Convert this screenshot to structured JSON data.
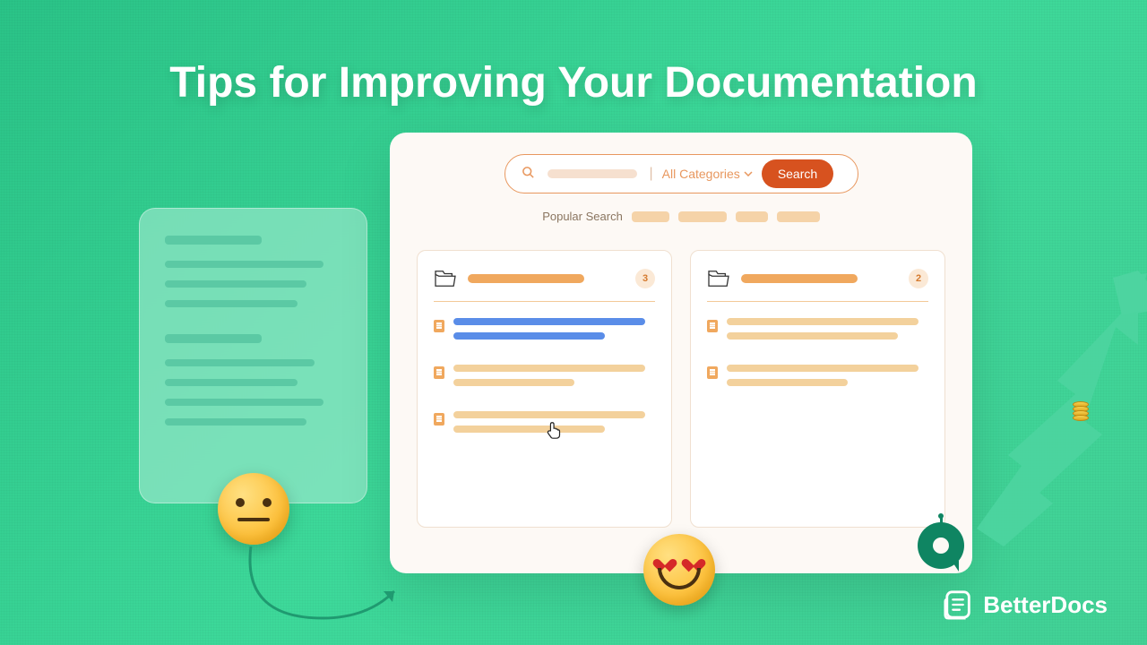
{
  "title": "Tips for Improving Your Documentation",
  "search": {
    "category_label": "All Categories",
    "button": "Search"
  },
  "popular_label": "Popular Search",
  "cards": [
    {
      "count": "3"
    },
    {
      "count": "2"
    }
  ],
  "brand": "BetterDocs"
}
